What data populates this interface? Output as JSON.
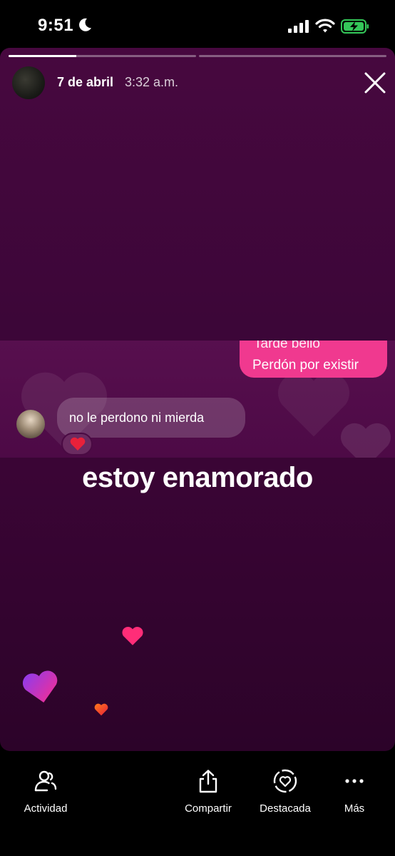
{
  "status_bar": {
    "time": "9:51",
    "icons": [
      "moon-icon",
      "cellular-signal-icon",
      "wifi-icon",
      "battery-charging-icon"
    ],
    "battery_color": "#34c759"
  },
  "story": {
    "progress_segments": [
      0.36,
      0.0
    ],
    "header": {
      "date": "7 de abril",
      "time": "3:32 a.m."
    },
    "chat": {
      "sent_partial": "Tarde bello",
      "sent_message": "Perdón por existir",
      "received_message": "no le perdono ni mierda",
      "reaction": "heart"
    },
    "caption": "estoy enamorado",
    "colors": {
      "sent_bubble": "#f0398f",
      "background": "#3c0638"
    }
  },
  "bottom_bar": {
    "activity": "Actividad",
    "share": "Compartir",
    "highlight": "Destacada",
    "more": "Más"
  }
}
